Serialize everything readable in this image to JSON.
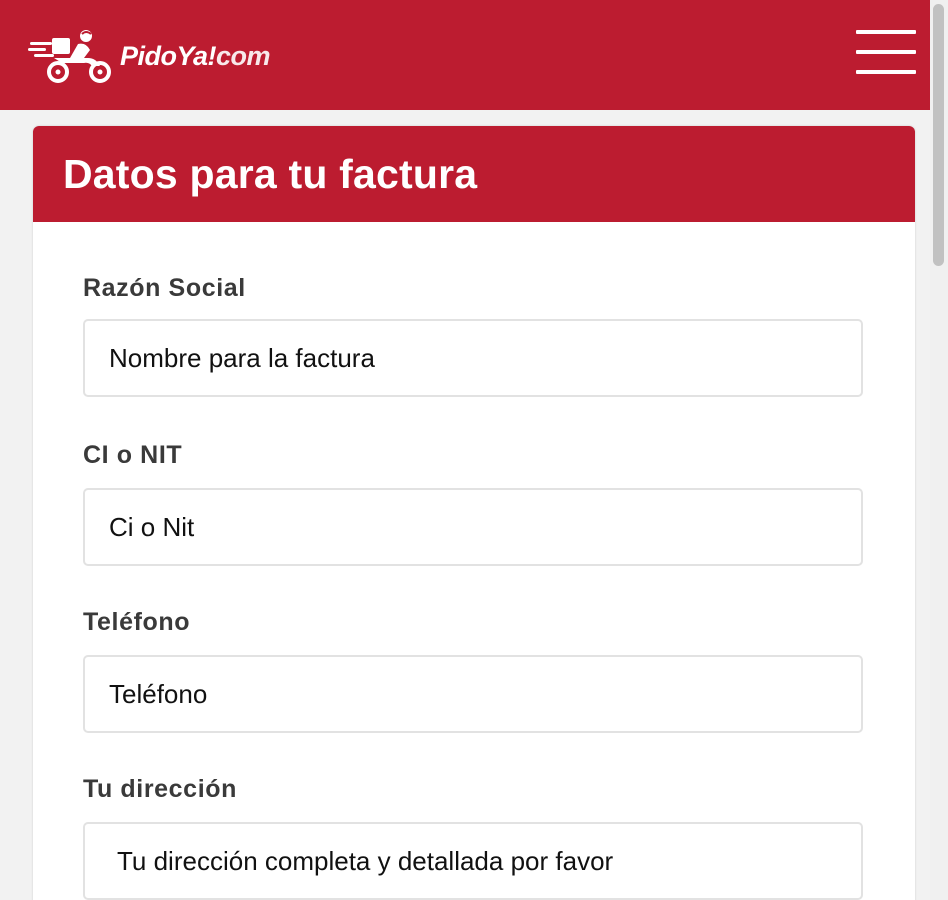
{
  "header": {
    "logo_text": "PidoYa!",
    "logo_suffix": "com",
    "brand_color": "#bc1c30",
    "menu_icon": "hamburger-menu-icon"
  },
  "card": {
    "title": "Datos para tu factura"
  },
  "form": {
    "fields": [
      {
        "label": "Razón Social",
        "placeholder": "Nombre para la factura"
      },
      {
        "label": "CI o NIT",
        "placeholder": "Ci o Nit"
      },
      {
        "label": "Teléfono",
        "placeholder": "Teléfono"
      },
      {
        "label": "Tu dirección",
        "placeholder": "Tu dirección completa y detallada por favor"
      }
    ]
  }
}
